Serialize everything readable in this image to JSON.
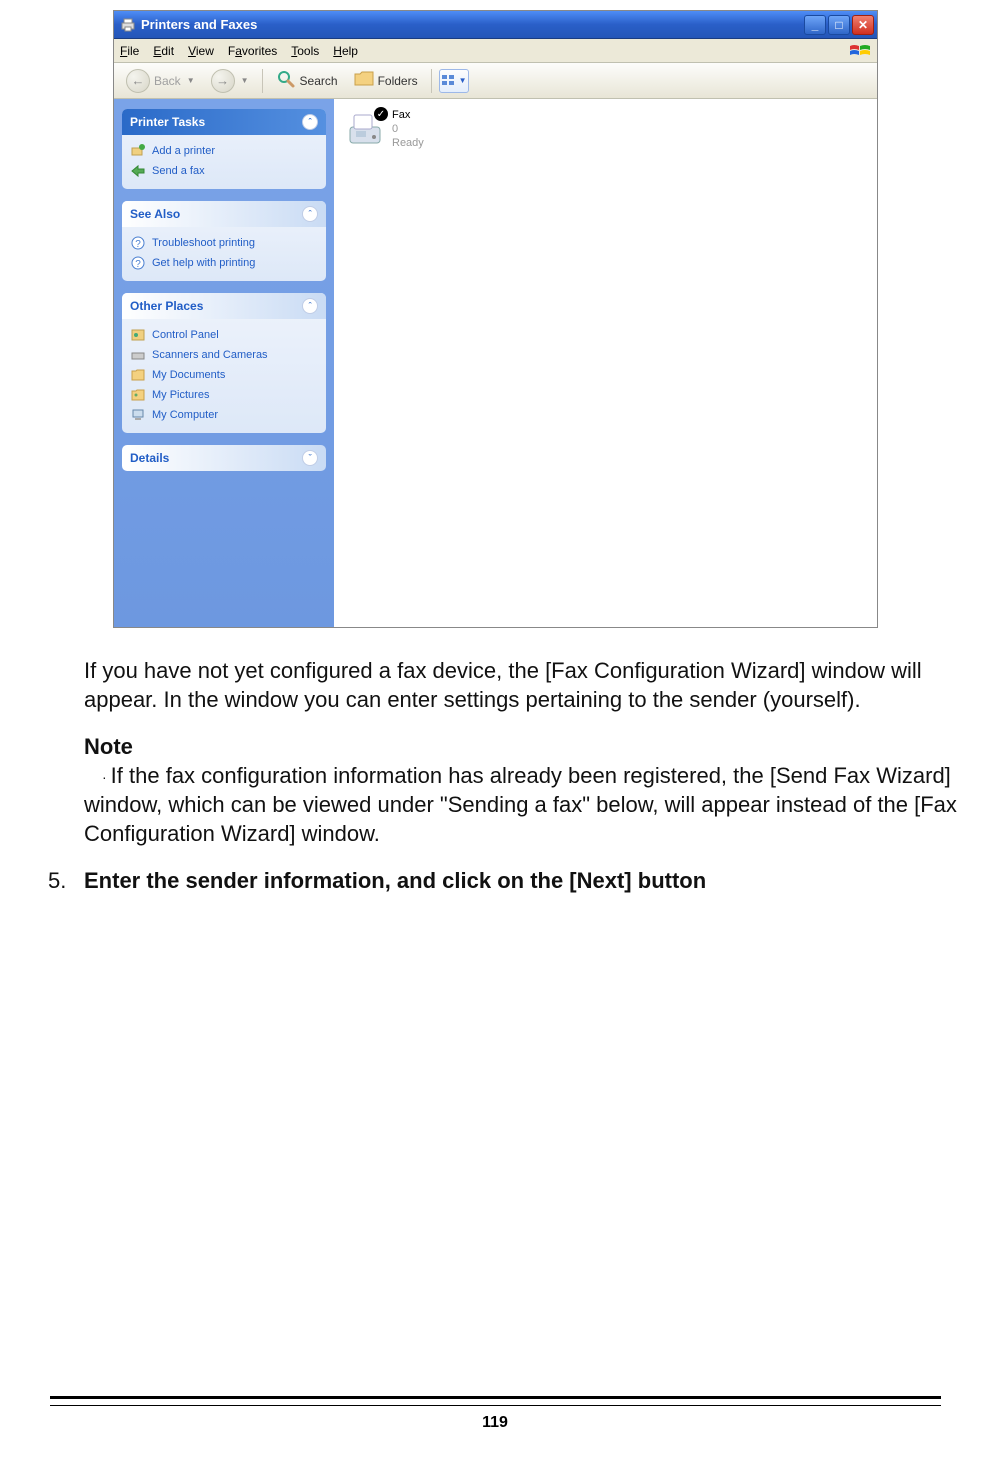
{
  "window": {
    "title": "Printers and Faxes",
    "menus": [
      "File",
      "Edit",
      "View",
      "Favorites",
      "Tools",
      "Help"
    ],
    "toolbar": {
      "back": "Back",
      "search": "Search",
      "folders": "Folders"
    },
    "sidebar": {
      "printer_tasks": {
        "header": "Printer Tasks",
        "items": [
          "Add a printer",
          "Send a fax"
        ]
      },
      "see_also": {
        "header": "See Also",
        "items": [
          "Troubleshoot printing",
          "Get help with printing"
        ]
      },
      "other_places": {
        "header": "Other Places",
        "items": [
          "Control Panel",
          "Scanners and Cameras",
          "My Documents",
          "My Pictures",
          "My Computer"
        ]
      },
      "details": {
        "header": "Details"
      }
    },
    "content_item": {
      "name": "Fax",
      "count": "0",
      "status": "Ready"
    }
  },
  "doc": {
    "para1": "If you have not yet configured a fax device, the [Fax Configuration Wizard] window will appear. In the window you can enter settings pertaining to the sender (yourself).",
    "note_label": "Note",
    "note_text": "If the fax configuration information has already been registered, the [Send Fax Wizard] window, which can be viewed under \"Sending a fax\" below, will appear instead of the [Fax Configuration Wizard] window.",
    "step_num": "5.",
    "step_text": "Enter the sender information, and click on the [Next] button",
    "page_number": "119"
  }
}
